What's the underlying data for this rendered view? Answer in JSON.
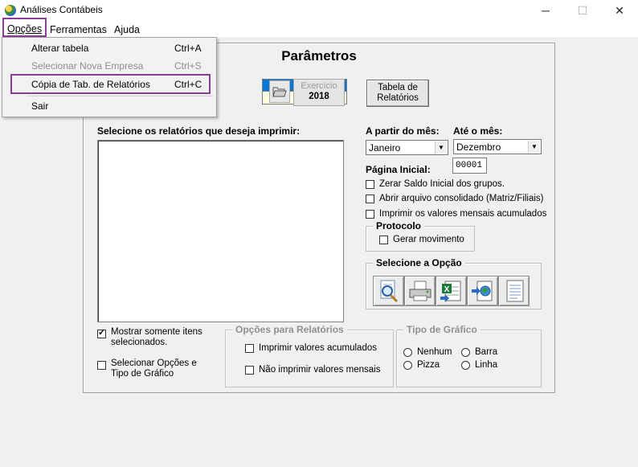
{
  "window": {
    "title": "Análises Contábeis",
    "min_glyph": "─",
    "max_glyph": "☐",
    "close_glyph": "✕"
  },
  "menubar": {
    "opcoes": "Opções",
    "ferramentas": "Ferramentas",
    "ajuda": "Ajuda"
  },
  "dropdown": {
    "items": [
      {
        "label": "Alterar tabela",
        "shortcut": "Ctrl+A",
        "enabled": true
      },
      {
        "label": "Selecionar Nova Empresa",
        "shortcut": "Ctrl+S",
        "enabled": false
      },
      {
        "label": "Cópia de Tab. de Relatórios",
        "shortcut": "Ctrl+C",
        "enabled": true,
        "highlighted": true
      },
      {
        "label": "Sair",
        "shortcut": "",
        "enabled": true
      }
    ]
  },
  "panel": {
    "title": "Parâmetros",
    "exercicio": {
      "label": "Exercício",
      "value": "2018"
    },
    "tabela_button": {
      "line1": "Tabela de",
      "line2": "Relatórios"
    },
    "relatorios_label": "Selecione os relatórios que deseja imprimir:",
    "relatorios_items": [],
    "a_partir_label": "A partir do mês:",
    "a_partir_value": "Janeiro",
    "ate_label": "Até o mês:",
    "ate_value": "Dezembro",
    "pagina_label": "Página Inicial:",
    "pagina_value": "00001",
    "options": {
      "zerar": "Zerar Saldo Inicial dos grupos.",
      "abrir": "Abrir arquivo consolidado (Matriz/Filiais)",
      "imprimir": "Imprimir os valores mensais acumulados"
    },
    "protocolo": {
      "legend": "Protocolo",
      "gerar": "Gerar movimento"
    },
    "selecione_opcao": {
      "legend": "Selecione a Opção",
      "icons": [
        "preview-magnifier-icon",
        "printer-icon",
        "excel-export-icon",
        "web-export-icon",
        "text-document-icon"
      ]
    },
    "mostrar": "Mostrar somente itens selecionados.",
    "selecionar_opcoes": "Selecionar Opções e Tipo de Gráfico",
    "opcoes_relatorios": {
      "legend": "Opções para Relatórios",
      "acumulados": "Imprimir valores acumulados",
      "nao_mensais": "Não imprimir valores mensais"
    },
    "tipo_grafico": {
      "legend": "Tipo de Gráfico",
      "nenhum": "Nenhum",
      "barra": "Barra",
      "pizza": "Pizza",
      "linha": "Linha"
    }
  },
  "colors": {
    "accent_highlight": "#8b3c96",
    "selection_blue": "#0078d7",
    "field_yellow": "#ffffe1"
  }
}
